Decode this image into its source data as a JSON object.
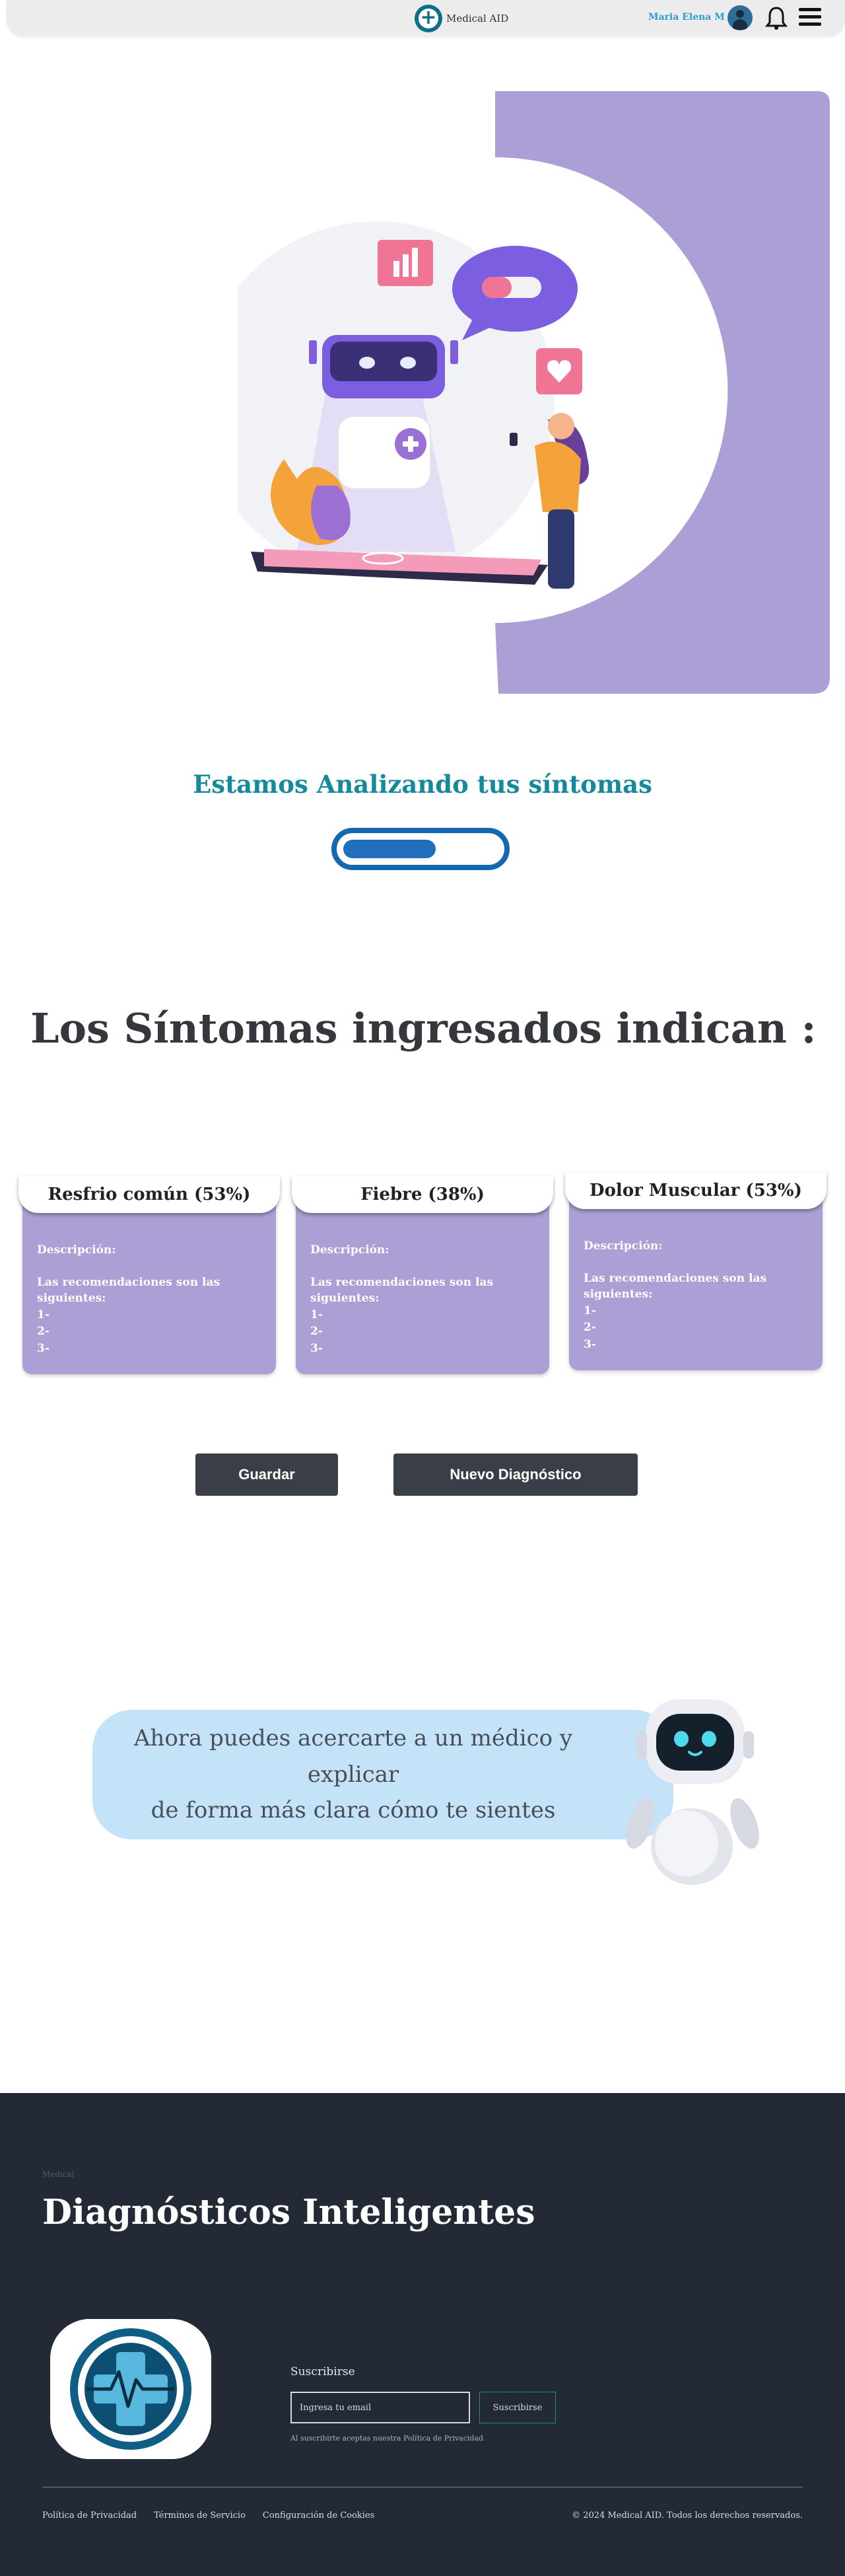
{
  "header": {
    "brand": "Medical AID",
    "user_name": "Maria Elena M"
  },
  "icons": {
    "brand": "medical-cross-logo-icon",
    "avatar": "user-avatar-icon",
    "notifications": "bell-icon",
    "menu": "hamburger-menu-icon"
  },
  "hero": {
    "illustration": "ai-health-robot-illustration"
  },
  "analysis": {
    "status_text": "Estamos Analizando tus síntomas",
    "progress_fraction": 0.6
  },
  "results": {
    "title": "Los Síntomas  ingresados  indican :",
    "cards": [
      {
        "title": "Resfrio común (53%)",
        "description_label": "Descripción:",
        "recommendations_label": "Las recomendaciones son las siguientes:",
        "items": [
          "1-",
          "2-",
          "3-"
        ]
      },
      {
        "title": "Fiebre (38%)",
        "description_label": "Descripción:",
        "recommendations_label": "Las recomendaciones son las siguientes:",
        "items": [
          "1-",
          "2-",
          "3-"
        ]
      },
      {
        "title": "Dolor Muscular (53%)",
        "description_label": "Descripción:",
        "recommendations_label": "Las recomendaciones son las siguientes:",
        "items": [
          "1-",
          "2-",
          "3-"
        ]
      }
    ]
  },
  "actions": {
    "save_label": "Guardar",
    "new_label": "Nuevo Diagnóstico"
  },
  "banner": {
    "line1": "Ahora puedes acercarte a un médico y explicar",
    "line2": "de forma más clara cómo te sientes"
  },
  "footer": {
    "small_label": "Medical",
    "title": "Diagnósticos Inteligentes",
    "subscribe_label": "Suscribirse",
    "email_placeholder": "Ingresa tu email",
    "subscribe_button": "Suscribirse",
    "note": "Al suscribirte aceptas nuestra Política de Privacidad",
    "links": [
      "Política de Privacidad",
      "Términos de Servicio",
      "Configuración de Cookies"
    ],
    "copyright": "© 2024 Medical AID. Todos los derechos reservados."
  },
  "colors": {
    "accent_purple": "#ac9fd6",
    "teal_title": "#148a9c",
    "progress_blue": "#1568b0",
    "footer_bg": "#232a36",
    "banner_bg": "#c4e3f8",
    "button_dark": "#3a3e46"
  }
}
